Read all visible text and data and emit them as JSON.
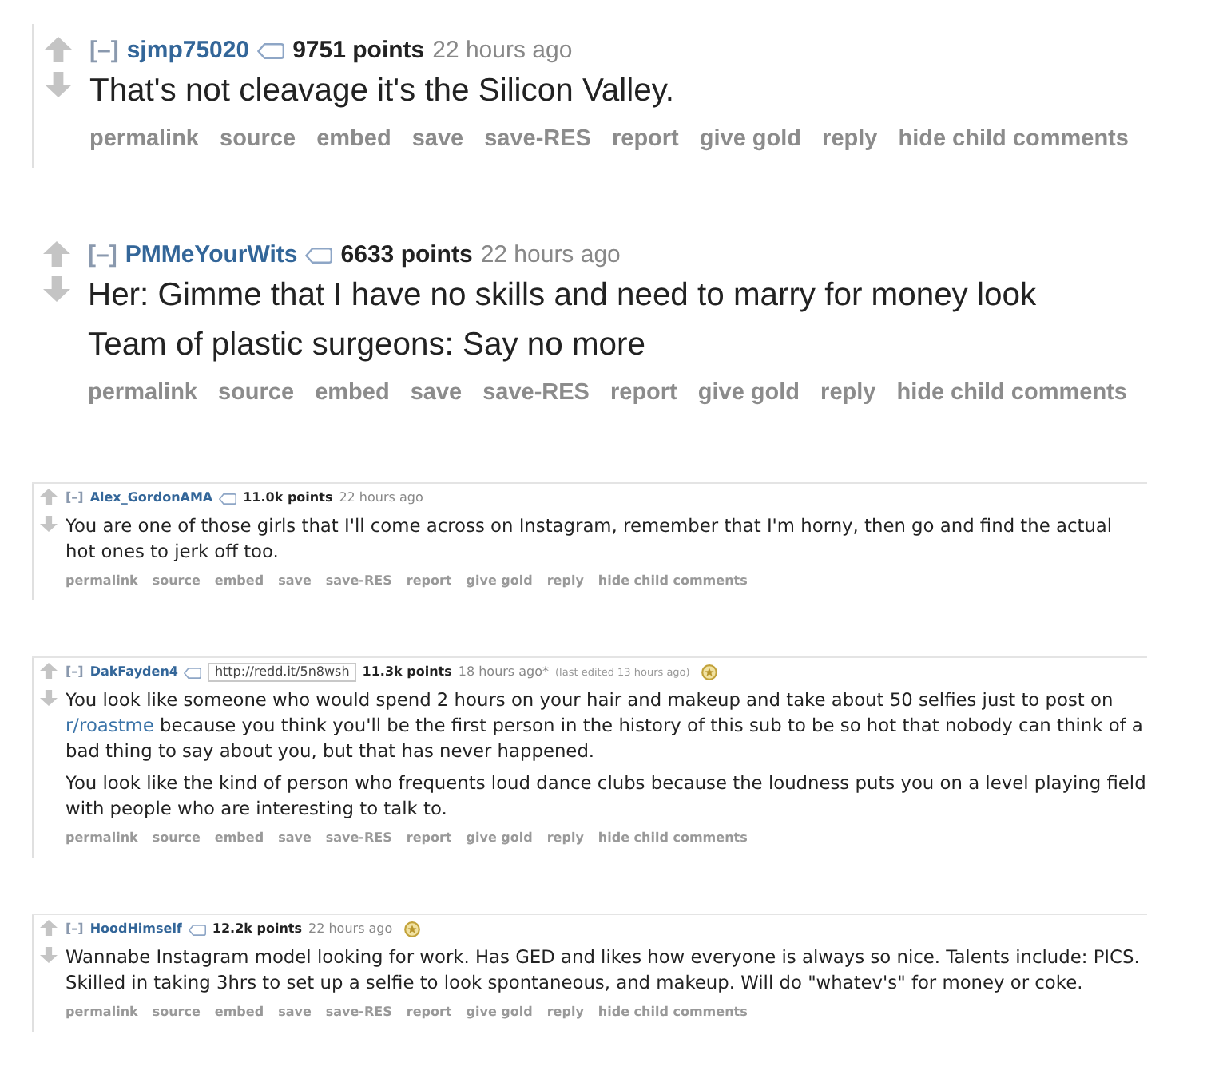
{
  "comments": [
    {
      "kind": "large",
      "framed": true,
      "collapse": "[–]",
      "author": "sjmp75020",
      "points": "9751 points",
      "time": "22 hours ago",
      "gilded": false,
      "paragraphs": [
        [
          {
            "kind": "text",
            "text": "That's not cleavage it's the Silicon Valley."
          }
        ]
      ],
      "actions": [
        "permalink",
        "source",
        "embed",
        "save",
        "save-RES",
        "report",
        "give gold",
        "reply",
        "hide child comments"
      ]
    },
    {
      "kind": "large",
      "framed": false,
      "collapse": "[–]",
      "author": "PMMeYourWits",
      "points": "6633 points",
      "time": "22 hours ago",
      "gilded": false,
      "paragraphs": [
        [
          {
            "kind": "text",
            "text": "Her: Gimme that I have no skills and need to marry for money look"
          }
        ],
        [
          {
            "kind": "text",
            "text": "Team of plastic surgeons: Say no more"
          }
        ]
      ],
      "actions": [
        "permalink",
        "source",
        "embed",
        "save",
        "save-RES",
        "report",
        "give gold",
        "reply",
        "hide child comments"
      ]
    },
    {
      "kind": "small",
      "framed": true,
      "collapse": "[–]",
      "author": "Alex_GordonAMA",
      "points": "11.0k points",
      "time": "22 hours ago",
      "gilded": false,
      "paragraphs": [
        [
          {
            "kind": "text",
            "text": "You are one of those girls that I'll come across on Instagram, remember that I'm horny, then go and find the actual hot ones to jerk off too."
          }
        ]
      ],
      "actions": [
        "permalink",
        "source",
        "embed",
        "save",
        "save-RES",
        "report",
        "give gold",
        "reply",
        "hide child comments"
      ]
    },
    {
      "kind": "small",
      "framed": true,
      "collapse": "[–]",
      "author": "DakFayden4",
      "shortlink": "http://redd.it/5n8wsh",
      "points": "11.3k points",
      "time": "18 hours ago*",
      "edited": "(last edited 13 hours ago)",
      "gilded": true,
      "paragraphs": [
        [
          {
            "kind": "text",
            "text": "You look like someone who would spend 2 hours on your hair and makeup and take about 50 selfies just to post on "
          },
          {
            "kind": "link",
            "text": "r/roastme"
          },
          {
            "kind": "text",
            "text": " because you think you'll be the first person in the history of this sub to be so hot that nobody can think of a bad thing to say about you, but that has never happened."
          }
        ],
        [
          {
            "kind": "text",
            "text": "You look like the kind of person who frequents loud dance clubs because the loudness puts you on a level playing field with people who are interesting to talk to."
          }
        ]
      ],
      "actions": [
        "permalink",
        "source",
        "embed",
        "save",
        "save-RES",
        "report",
        "give gold",
        "reply",
        "hide child comments"
      ]
    },
    {
      "kind": "small",
      "framed": true,
      "collapse": "[–]",
      "author": "HoodHimself",
      "points": "12.2k points",
      "time": "22 hours ago",
      "gilded": true,
      "paragraphs": [
        [
          {
            "kind": "text",
            "text": "Wannabe Instagram model looking for work. Has GED and likes how everyone is always so nice. Talents include: PICS. Skilled in taking 3hrs to set up a selfie to look spontaneous, and makeup. Will do \"whatev's\" for money or coke."
          }
        ]
      ],
      "actions": [
        "permalink",
        "source",
        "embed",
        "save",
        "save-RES",
        "report",
        "give gold",
        "reply",
        "hide child comments"
      ]
    }
  ]
}
